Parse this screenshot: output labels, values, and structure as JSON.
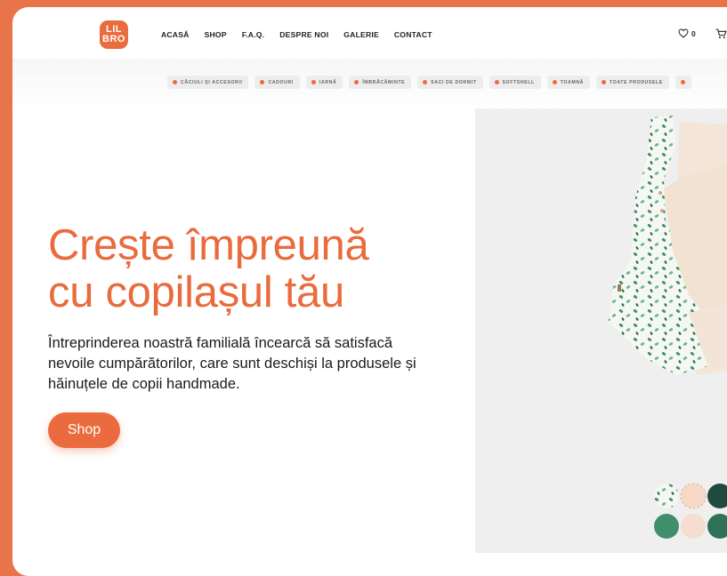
{
  "header": {
    "logo": {
      "line1": "LIL",
      "line2": "BRO"
    },
    "nav": [
      "ACASĂ",
      "SHOP",
      "F.A.Q.",
      "DESPRE NOI",
      "GALERIE",
      "CONTACT"
    ],
    "wishlist_count": "0"
  },
  "categories": [
    "CĂCIULI ȘI ACCESORII",
    "CADOURI",
    "IARNĂ",
    "ÎMBRĂCĂMINTE",
    "SACI DE DORMIT",
    "SOFTSHELL",
    "TOAMNĂ",
    "TOATE PRODUSELE"
  ],
  "hero": {
    "title_line1": "Crește împreună",
    "title_line2": "cu copilașul tău",
    "description": "Întreprinderea noastră familială încearcă să satisfacă nevoile cumpărătorilor, care sunt deschiși la produsele și hăinuțele de copii handmade.",
    "button_label": "Shop"
  },
  "colors": {
    "accent": "#ea6b3d",
    "background": "#e8754a",
    "product_bg": "#efefef",
    "leaf": "#3f8f6c"
  },
  "icons": [
    "heart-icon",
    "cart-icon"
  ]
}
